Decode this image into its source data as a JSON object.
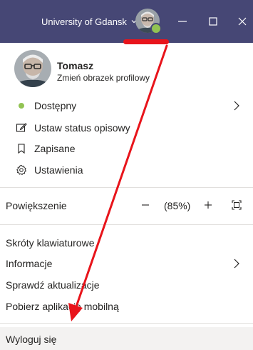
{
  "titlebar": {
    "org_name": "University of Gdansk",
    "bg_color": "#464775",
    "presence_color": "#92c353"
  },
  "profile": {
    "name": "Tomasz",
    "change_photo": "Zmień obrazek profilowy"
  },
  "status": {
    "label": "Dostępny",
    "icon": "available-dot-icon"
  },
  "menu": {
    "set_status_message": "Ustaw status opisowy",
    "saved": "Zapisane",
    "settings": "Ustawienia",
    "keyboard_shortcuts": "Skróty klawiaturowe",
    "about": "Informacje",
    "check_updates": "Sprawdź aktualizacje",
    "download_mobile": "Pobierz aplikację mobilną",
    "sign_out": "Wyloguj się"
  },
  "zoom": {
    "label": "Powiększenie",
    "minus": "−",
    "value": "(85%)",
    "plus": "+"
  },
  "annotation": {
    "color": "#e8141b"
  }
}
